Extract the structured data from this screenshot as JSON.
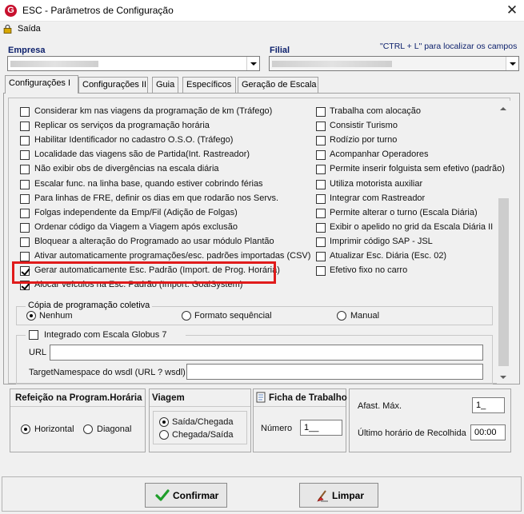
{
  "window": {
    "title": "ESC - Parâmetros de Configuração",
    "app_icon_letter": "G",
    "close_glyph": "✕"
  },
  "menu": {
    "exit": "Saída"
  },
  "header": {
    "empresa_label": "Empresa",
    "filial_label": "Filial",
    "hint": "\"CTRL + L\" para localizar os campos"
  },
  "tabs": [
    {
      "label": "Configurações I",
      "active": true
    },
    {
      "label": "Configurações II"
    },
    {
      "label": "Guia"
    },
    {
      "label": "Específicos"
    },
    {
      "label": "Geração de Escala"
    }
  ],
  "left_options": [
    {
      "label": "Considerar km nas viagens da programação de km (Tráfego)",
      "checked": false
    },
    {
      "label": "Replicar os serviços da programação horária",
      "checked": false
    },
    {
      "label": "Habilitar Identificador no cadastro O.S.O. (Tráfego)",
      "checked": false
    },
    {
      "label": "Localidade das viagens são de Partida(Int. Rastreador)",
      "checked": false
    },
    {
      "label": "Não exibir obs de divergências na escala diária",
      "checked": false
    },
    {
      "label": "Escalar func. na linha base, quando estiver cobrindo férias",
      "checked": false
    },
    {
      "label": "Para linhas de FRE, definir os dias em que rodarão nos Servs.",
      "checked": false
    },
    {
      "label": "Folgas independente da Emp/Fil (Adição de Folgas)",
      "checked": false
    },
    {
      "label": "Ordenar código da Viagem a Viagem após exclusão",
      "checked": false
    },
    {
      "label": "Bloquear a alteração do Programado ao usar módulo Plantão",
      "checked": false
    },
    {
      "label": "Ativar automaticamente programações/esc. padrões importadas (CSV)",
      "checked": false
    },
    {
      "label": "Gerar automaticamente Esc. Padrão (Import. de Prog. Horária)",
      "checked": true
    },
    {
      "label": "Alocar veículos na Esc. Padrão (Import. GoalSystem)",
      "checked": true
    }
  ],
  "right_options": [
    {
      "label": "Trabalha com alocação",
      "checked": false
    },
    {
      "label": "Consistir Turismo",
      "checked": false
    },
    {
      "label": "Rodízio por turno",
      "checked": false
    },
    {
      "label": "Acompanhar Operadores",
      "checked": false
    },
    {
      "label": "Permite inserir folguista sem efetivo (padrão)",
      "checked": false
    },
    {
      "label": "Utiliza motorista auxiliar",
      "checked": false
    },
    {
      "label": "Integrar com Rastreador",
      "checked": false
    },
    {
      "label": "Permite alterar o turno (Escala Diária)",
      "checked": false
    },
    {
      "label": "Exibir o apelido no grid da Escala Diária II",
      "checked": false
    },
    {
      "label": "Imprimir código SAP - JSL",
      "checked": false
    },
    {
      "label": "Atualizar Esc. Diária (Esc. 02)",
      "checked": false
    },
    {
      "label": "Efetivo fixo no carro",
      "checked": false
    }
  ],
  "copia": {
    "title": "Cópia de programação coletiva",
    "options": [
      {
        "label": "Nenhum",
        "selected": true
      },
      {
        "label": "Formato sequêncial",
        "selected": false
      },
      {
        "label": "Manual",
        "selected": false
      }
    ]
  },
  "globus": {
    "title": "Integrado com Escala Globus 7",
    "checked": false,
    "url_label": "URL",
    "url_value": "",
    "ns_label": "TargetNamespace do wsdl (URL ? wsdl)",
    "ns_value": ""
  },
  "refeicao": {
    "title": "Refeição na Program.Horária",
    "options": [
      {
        "label": "Horizontal",
        "selected": true
      },
      {
        "label": "Diagonal",
        "selected": false
      }
    ]
  },
  "viagem": {
    "title": "Viagem",
    "options": [
      {
        "label": "Saída/Chegada",
        "selected": true
      },
      {
        "label": "Chegada/Saída",
        "selected": false
      }
    ]
  },
  "ficha": {
    "title": "Ficha de Trabalho",
    "numero_label": "Número",
    "numero_value": "1__"
  },
  "afast": {
    "max_label": "Afast. Máx.",
    "max_value": "1_",
    "recolhida_label": "Último horário de Recolhida",
    "recolhida_value": "00:00"
  },
  "buttons": {
    "confirm": "Confirmar",
    "clear": "Limpar"
  },
  "colors": {
    "highlight": "#e01b1b",
    "accent": "#0b1f6b",
    "confirm_icon": "#1e9e2a"
  }
}
